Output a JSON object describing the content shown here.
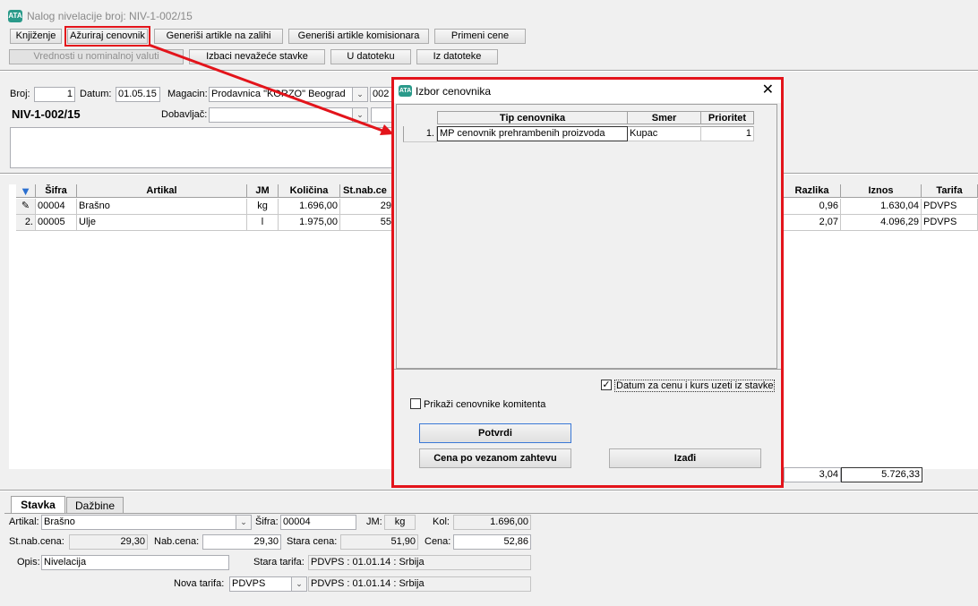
{
  "window": {
    "title": "Nalog nivelacije broj: NIV-1-002/15",
    "icon": "app-logo-icon"
  },
  "toolbar": {
    "row1": [
      "Knjiženje",
      "Ažuriraj cenovnik",
      "Generiši artikle na zalihi",
      "Generiši artikle komisionara",
      "Primeni cene"
    ],
    "row2": [
      "Vrednosti u nominalnoj valuti",
      "Izbaci nevažeće stavke",
      "U datoteku",
      "Iz datoteke"
    ]
  },
  "header": {
    "broj_label": "Broj:",
    "broj_value": "1",
    "datum_label": "Datum:",
    "datum_value": "01.05.15",
    "magacin_label": "Magacin:",
    "magacin_value": "Prodavnica \"KORZO\" Beograd",
    "magacin_code": "002",
    "doc_number": "NIV-1-002/15",
    "dobavljac_label": "Dobavljač:",
    "dobavljac_value": ""
  },
  "grid": {
    "columns": [
      "Šifra",
      "Artikal",
      "JM",
      "Količina",
      "St.nab.ce",
      "Razlika",
      "Iznos",
      "Tarifa"
    ],
    "rows": [
      {
        "num": "",
        "sifra": "00004",
        "artikal": "Brašno",
        "jm": "kg",
        "kolicina": "1.696,00",
        "stnab": "29",
        "razlika": "0,96",
        "iznos": "1.630,04",
        "tarifa": "PDVPS"
      },
      {
        "num": "2.",
        "sifra": "00005",
        "artikal": "Ulje",
        "jm": "l",
        "kolicina": "1.975,00",
        "stnab": "55",
        "razlika": "2,07",
        "iznos": "4.096,29",
        "tarifa": "PDVPS"
      }
    ],
    "totals": {
      "razlika": "3,04",
      "iznos": "5.726,33"
    }
  },
  "dialog": {
    "title": "Izbor cenovnika",
    "columns": [
      "Tip cenovnika",
      "Smer",
      "Prioritet"
    ],
    "rows": [
      {
        "num": "1.",
        "tip": "MP cenovnik prehrambenih proizvoda",
        "smer": "Kupac",
        "prioritet": "1"
      }
    ],
    "checkbox_datum": {
      "label": "Datum za cenu i kurs uzeti iz stavke",
      "checked": true
    },
    "checkbox_prikazi": {
      "label": "Prikaži cenovnike komitenta",
      "checked": false
    },
    "btn_potvrdi": "Potvrdi",
    "btn_cena": "Cena po vezanom zahtevu",
    "btn_izadji": "Izađi"
  },
  "tabs": [
    "Stavka",
    "Dažbine"
  ],
  "stavka": {
    "artikal_label": "Artikal:",
    "artikal_value": "Brašno",
    "sifra_label": "Šifra:",
    "sifra_value": "00004",
    "jm_label": "JM:",
    "jm_value": "kg",
    "kol_label": "Kol:",
    "kol_value": "1.696,00",
    "stnab_label": "St.nab.cena:",
    "stnab_value": "29,30",
    "nab_label": "Nab.cena:",
    "nab_value": "29,30",
    "stara_label": "Stara cena:",
    "stara_value": "51,90",
    "cena_label": "Cena:",
    "cena_value": "52,86",
    "opis_label": "Opis:",
    "opis_value": "Nivelacija",
    "stara_tarifa_label": "Stara tarifa:",
    "stara_tarifa_value": "PDVPS : 01.01.14 : Srbija",
    "nova_tarifa_label": "Nova tarifa:",
    "nova_tarifa_code": "PDVPS",
    "nova_tarifa_value": "PDVPS : 01.01.14 : Srbija"
  },
  "colors": {
    "highlight": "#e3141b",
    "accent": "#2a9a8a"
  }
}
